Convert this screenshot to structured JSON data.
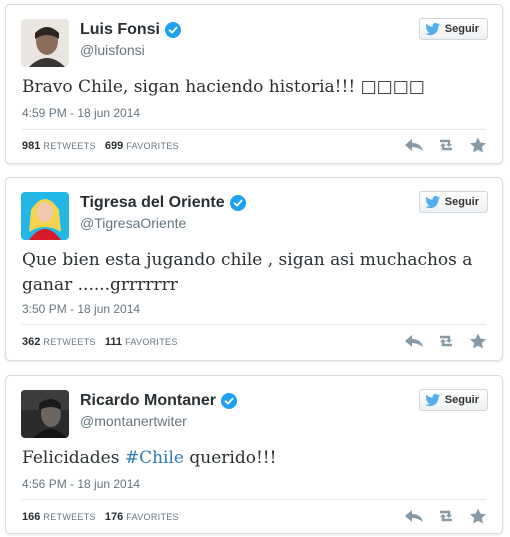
{
  "follow_label": "Seguir",
  "labels": {
    "retweets": "RETWEETS",
    "favorites": "FAVORITES"
  },
  "colors": {
    "link": "#2b7bb9",
    "twitter_blue": "#55acee",
    "verified": "#1da1f2",
    "muted": "#66757f",
    "icon": "#8899a6"
  },
  "tweets": [
    {
      "name": "Luis Fonsi",
      "handle": "@luisfonsi",
      "text": "Bravo Chile, sigan haciendo historia!!! □□□□",
      "time": "4:59 PM - 18 jun 2014",
      "retweets": "981",
      "favorites": "699"
    },
    {
      "name": "Tigresa del Oriente",
      "handle": "@TigresaOriente",
      "text": "Que bien esta jugando chile , sigan asi muchachos a ganar ......grrrrrrr",
      "time": "3:50 PM - 18 jun 2014",
      "retweets": "362",
      "favorites": "111"
    },
    {
      "name": "Ricardo Montaner",
      "handle": "@montanertwiter",
      "text_before": "Felicidades ",
      "hashtag": "#Chile",
      "text_after": " querido!!!",
      "time": "4:56 PM - 18 jun 2014",
      "retweets": "166",
      "favorites": "176"
    }
  ]
}
